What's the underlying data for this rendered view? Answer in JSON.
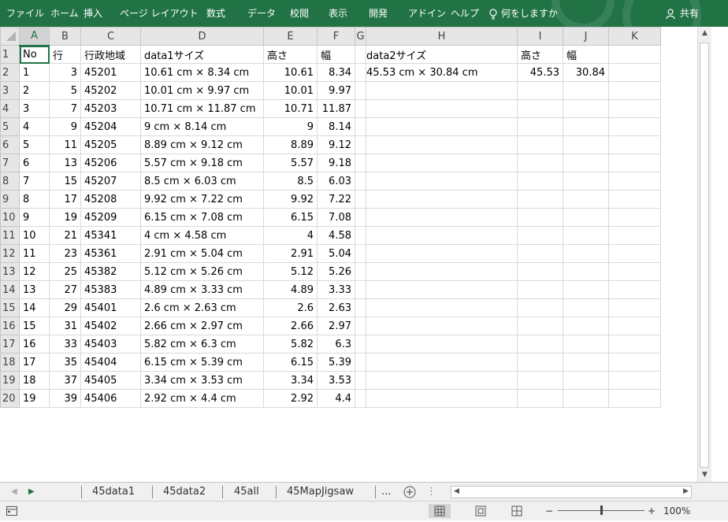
{
  "ribbon": {
    "tabs": [
      "ファイル",
      "ホーム",
      "挿入",
      "ページ レイアウト",
      "数式",
      "データ",
      "校閲",
      "表示",
      "開発",
      "アドイン",
      "ヘルプ"
    ],
    "tell_me": "何をしますか",
    "share": "共有",
    "bg_color": "#217346"
  },
  "sheet": {
    "columns": [
      "A",
      "B",
      "C",
      "D",
      "E",
      "F",
      "G",
      "H",
      "I",
      "J",
      "K"
    ],
    "selected_column": "A",
    "rows": [
      {
        "n": "1",
        "cells": [
          "No",
          "行",
          "行政地域",
          "data1サイズ",
          "高さ",
          "幅",
          "",
          "data2サイズ",
          "高さ",
          "幅",
          ""
        ]
      },
      {
        "n": "2",
        "cells": [
          "1",
          "3",
          "45201",
          "10.61 cm × 8.34 cm",
          "10.61",
          "8.34",
          "",
          "45.53 cm ×  30.84 cm",
          "45.53",
          "30.84",
          ""
        ]
      },
      {
        "n": "3",
        "cells": [
          "2",
          "5",
          "45202",
          "10.01 cm × 9.97 cm",
          "10.01",
          "9.97",
          "",
          "",
          "",
          "",
          ""
        ]
      },
      {
        "n": "4",
        "cells": [
          "3",
          "7",
          "45203",
          "10.71 cm × 11.87 cm",
          "10.71",
          "11.87",
          "",
          "",
          "",
          "",
          ""
        ]
      },
      {
        "n": "5",
        "cells": [
          "4",
          "9",
          "45204",
          "9 cm × 8.14 cm",
          "9",
          "8.14",
          "",
          "",
          "",
          "",
          ""
        ]
      },
      {
        "n": "6",
        "cells": [
          "5",
          "11",
          "45205",
          "8.89 cm × 9.12 cm",
          "8.89",
          "9.12",
          "",
          "",
          "",
          "",
          ""
        ]
      },
      {
        "n": "7",
        "cells": [
          "6",
          "13",
          "45206",
          "5.57 cm × 9.18 cm",
          "5.57",
          "9.18",
          "",
          "",
          "",
          "",
          ""
        ]
      },
      {
        "n": "8",
        "cells": [
          "7",
          "15",
          "45207",
          "8.5 cm × 6.03 cm",
          "8.5",
          "6.03",
          "",
          "",
          "",
          "",
          ""
        ]
      },
      {
        "n": "9",
        "cells": [
          "8",
          "17",
          "45208",
          "9.92 cm × 7.22 cm",
          "9.92",
          "7.22",
          "",
          "",
          "",
          "",
          ""
        ]
      },
      {
        "n": "10",
        "cells": [
          "9",
          "19",
          "45209",
          "6.15 cm × 7.08 cm",
          "6.15",
          "7.08",
          "",
          "",
          "",
          "",
          ""
        ]
      },
      {
        "n": "11",
        "cells": [
          "10",
          "21",
          "45341",
          "4 cm × 4.58 cm",
          "4",
          "4.58",
          "",
          "",
          "",
          "",
          ""
        ]
      },
      {
        "n": "12",
        "cells": [
          "11",
          "23",
          "45361",
          "2.91 cm × 5.04 cm",
          "2.91",
          "5.04",
          "",
          "",
          "",
          "",
          ""
        ]
      },
      {
        "n": "13",
        "cells": [
          "12",
          "25",
          "45382",
          "5.12 cm × 5.26 cm",
          "5.12",
          "5.26",
          "",
          "",
          "",
          "",
          ""
        ]
      },
      {
        "n": "14",
        "cells": [
          "13",
          "27",
          "45383",
          "4.89 cm × 3.33 cm",
          "4.89",
          "3.33",
          "",
          "",
          "",
          "",
          ""
        ]
      },
      {
        "n": "15",
        "cells": [
          "14",
          "29",
          "45401",
          "2.6 cm × 2.63 cm",
          "2.6",
          "2.63",
          "",
          "",
          "",
          "",
          ""
        ]
      },
      {
        "n": "16",
        "cells": [
          "15",
          "31",
          "45402",
          "2.66 cm × 2.97 cm",
          "2.66",
          "2.97",
          "",
          "",
          "",
          "",
          ""
        ]
      },
      {
        "n": "17",
        "cells": [
          "16",
          "33",
          "45403",
          "5.82 cm × 6.3 cm",
          "5.82",
          "6.3",
          "",
          "",
          "",
          "",
          ""
        ]
      },
      {
        "n": "18",
        "cells": [
          "17",
          "35",
          "45404",
          "6.15 cm × 5.39 cm",
          "6.15",
          "5.39",
          "",
          "",
          "",
          "",
          ""
        ]
      },
      {
        "n": "19",
        "cells": [
          "18",
          "37",
          "45405",
          "3.34 cm × 3.53 cm",
          "3.34",
          "3.53",
          "",
          "",
          "",
          "",
          ""
        ]
      },
      {
        "n": "20",
        "cells": [
          "19",
          "39",
          "45406",
          "2.92 cm × 4.4 cm",
          "2.92",
          "4.4",
          "",
          "",
          "",
          "",
          ""
        ]
      }
    ]
  },
  "sheet_tabs": {
    "tabs": [
      "45data1",
      "45data2",
      "45all",
      "45MapJigsaw"
    ],
    "more": "...",
    "add_icon": "plus-circle-icon"
  },
  "status": {
    "zoom": "100%",
    "accent": "#217346"
  }
}
